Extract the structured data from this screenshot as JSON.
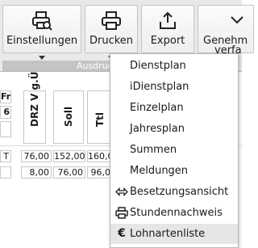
{
  "ribbon": {
    "buttons": [
      {
        "label": "Einstellungen",
        "icon": "printer-search-icon"
      },
      {
        "label": "Drucken",
        "icon": "printer-icon"
      },
      {
        "label": "Export",
        "icon": "export-icon"
      },
      {
        "label": "Genehm",
        "label2": "verfa",
        "icon": "chevron-icon"
      }
    ],
    "group_label": "Ausdruck"
  },
  "table": {
    "left_labels": [
      "Fr",
      "6"
    ],
    "headers": [
      "DRZ V g.Ü",
      "Soll",
      "Ttl"
    ],
    "rows": [
      {
        "first": "T",
        "values": [
          "76,00",
          "152,00",
          "160,0"
        ]
      },
      {
        "first": "",
        "values": [
          "8,00",
          "76,00",
          "96,0"
        ]
      }
    ]
  },
  "menu": {
    "items": [
      {
        "label": "Dienstplan",
        "icon": ""
      },
      {
        "label": "iDienstplan",
        "icon": ""
      },
      {
        "label": "Einzelplan",
        "icon": ""
      },
      {
        "label": "Jahresplan",
        "icon": ""
      },
      {
        "label": "Summen",
        "icon": ""
      },
      {
        "label": "Meldungen",
        "icon": ""
      },
      {
        "label": "Besetzungsansicht",
        "icon": "left-right-arrow-icon"
      },
      {
        "label": "Stundennachweis",
        "icon": "printer-icon"
      },
      {
        "label": "Lohnartenliste",
        "icon": "euro-icon"
      }
    ]
  }
}
